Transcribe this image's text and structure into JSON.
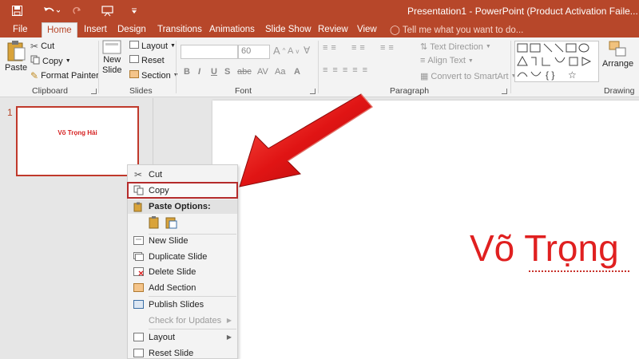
{
  "titlebar": {
    "title": "Presentation1 - PowerPoint (Product Activation Faile..."
  },
  "tabs": [
    {
      "label": "File"
    },
    {
      "label": "Home"
    },
    {
      "label": "Insert"
    },
    {
      "label": "Design"
    },
    {
      "label": "Transitions"
    },
    {
      "label": "Animations"
    },
    {
      "label": "Slide Show"
    },
    {
      "label": "Review"
    },
    {
      "label": "View"
    }
  ],
  "tell_me": "Tell me what you want to do...",
  "ribbon": {
    "clipboard": {
      "paste": "Paste",
      "cut": "Cut",
      "copy": "Copy",
      "format_painter": "Format Painter",
      "label": "Clipboard"
    },
    "slides": {
      "new_slide": "New",
      "new_slide2": "Slide",
      "layout": "Layout",
      "reset": "Reset",
      "section": "Section",
      "label": "Slides"
    },
    "font": {
      "size": "60",
      "label": "Font"
    },
    "paragraph": {
      "text_direction": "Text Direction",
      "align_text": "Align Text",
      "convert_smartart": "Convert to SmartArt",
      "label": "Paragraph"
    },
    "drawing": {
      "arrange": "Arrange",
      "label": "Drawing"
    }
  },
  "thumbnail": {
    "number": "1",
    "text": "Võ Trọng Hải"
  },
  "slide": {
    "text": "Võ Trọng"
  },
  "context_menu": {
    "cut": "Cut",
    "copy": "Copy",
    "paste_options": "Paste Options:",
    "new_slide": "New Slide",
    "duplicate_slide": "Duplicate Slide",
    "delete_slide": "Delete Slide",
    "add_section": "Add Section",
    "publish_slides": "Publish Slides",
    "check_updates": "Check for Updates",
    "layout": "Layout",
    "reset_slide": "Reset Slide"
  },
  "colors": {
    "accent": "#b7472a",
    "highlight": "#b52b2b",
    "slide_text": "#e02020"
  }
}
